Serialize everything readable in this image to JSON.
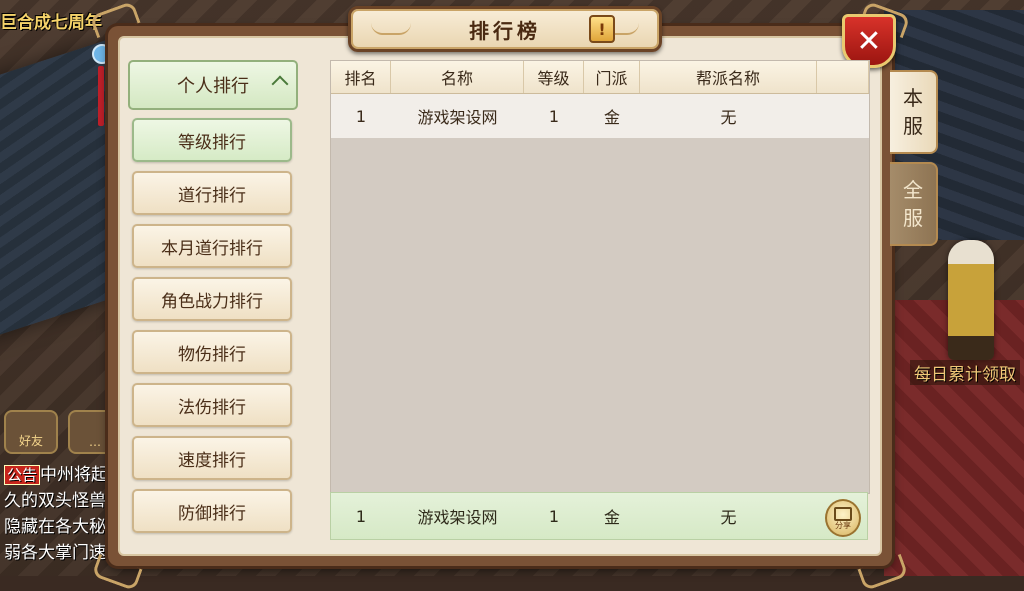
{
  "background": {
    "top_left_text": "巨合成七周年",
    "side_hint": "每日累计领取",
    "friend_label": "好友",
    "chat": {
      "tag": "公告",
      "lines": [
        "中州将起",
        "久的双头怪兽",
        "隐藏在各大秘",
        "弱各大掌门速"
      ]
    }
  },
  "window": {
    "title": "排行榜",
    "info_icon": "!",
    "close_icon": "✕"
  },
  "categories": {
    "header": "个人排行",
    "items": [
      "等级排行",
      "道行排行",
      "本月道行排行",
      "角色战力排行",
      "物伤排行",
      "法伤排行",
      "速度排行",
      "防御排行"
    ],
    "active_index": 0
  },
  "table": {
    "headers": [
      "排名",
      "名称",
      "等级",
      "门派",
      "帮派名称"
    ],
    "rows": [
      {
        "rank": "1",
        "name": "游戏架设网",
        "level": "1",
        "school": "金",
        "guild": "无"
      }
    ]
  },
  "my_row": {
    "rank": "1",
    "name": "游戏架设网",
    "level": "1",
    "school": "金",
    "guild": "无",
    "share_label": "分享"
  },
  "side_tabs": {
    "server": [
      "本",
      "服"
    ],
    "all": [
      "全",
      "服"
    ]
  },
  "colors": {
    "active_green": "#d6ebc6",
    "close_red": "#c0241c",
    "panel_brown": "#7a5236"
  }
}
